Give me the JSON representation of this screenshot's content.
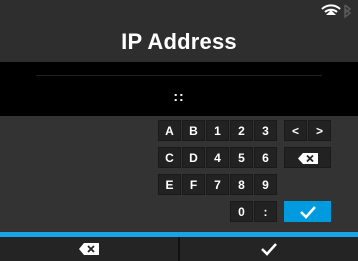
{
  "header": {
    "title": "IP Address",
    "status_icons": [
      "wifi-icon",
      "bluetooth-icon"
    ]
  },
  "input": {
    "value": "::"
  },
  "keypad": {
    "row1": [
      "A",
      "B",
      "1",
      "2",
      "3",
      "<",
      ">"
    ],
    "row2": [
      "C",
      "D",
      "4",
      "5",
      "6"
    ],
    "row2_special": "backspace-icon",
    "row3": [
      "E",
      "F",
      "7",
      "8",
      "9"
    ],
    "row4": [
      "0",
      ":"
    ],
    "row4_special": "checkmark-icon"
  },
  "footer": {
    "left_icon": "backspace-icon",
    "right_icon": "checkmark-icon"
  },
  "colors": {
    "accent": "#1aa3e8",
    "ok_key": "#009bde",
    "background": "#303030",
    "input_bg": "#000000"
  }
}
